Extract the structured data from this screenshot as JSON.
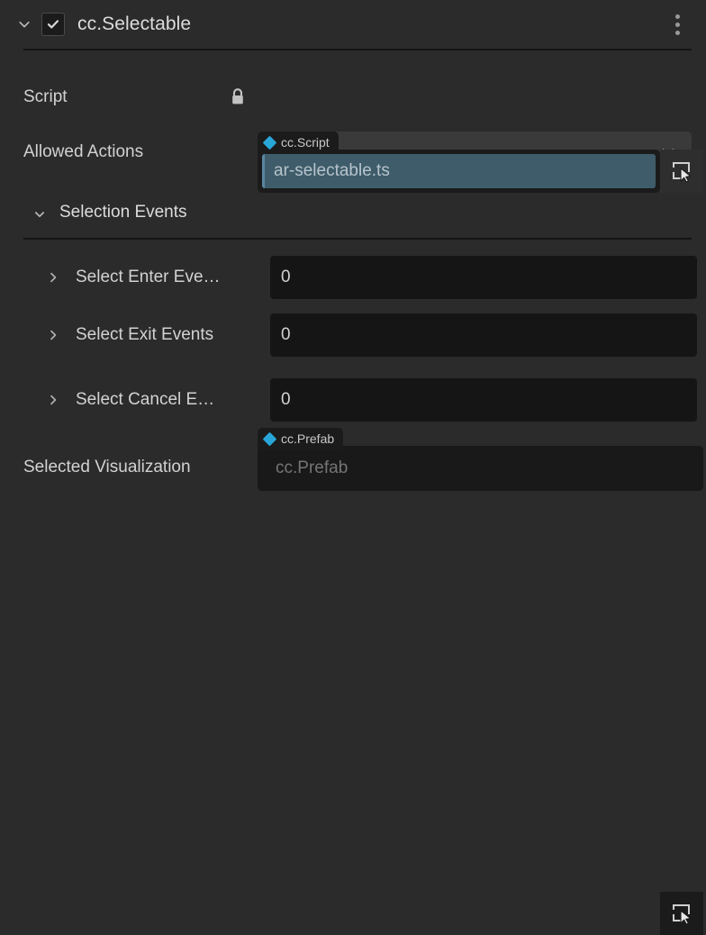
{
  "component": {
    "title": "cc.Selectable",
    "enabled_checkbox": true,
    "collapse_caret": "chevron-down-icon",
    "menu_icon": "kebab-menu-icon"
  },
  "script_row": {
    "label": "Script",
    "lock_icon": "lock-closed-icon",
    "type_badge": "cc.Script",
    "value": "ar-selectable.ts",
    "pick_icon": "node-picker-icon",
    "accent": "#29a6d8",
    "field_bg": "#3f5c6b"
  },
  "allowed_actions_row": {
    "label": "Allowed Actions",
    "value": "7",
    "caret_icon": "chevron-down-icon"
  },
  "selection_events_section": {
    "title": "Selection Events",
    "caret_icon": "chevron-down-icon",
    "rows": [
      {
        "label": "Select Enter Eve…",
        "value": "0",
        "caret_icon": "chevron-right-icon"
      },
      {
        "label": "Select Exit Events",
        "value": "0",
        "caret_icon": "chevron-right-icon"
      },
      {
        "label": "Select Cancel E…",
        "value": "0",
        "caret_icon": "chevron-right-icon"
      }
    ]
  },
  "selected_visualization_row": {
    "label": "Selected Visualization",
    "type_badge": "cc.Prefab",
    "value": "cc.Prefab",
    "pick_icon": "node-picker-icon"
  }
}
